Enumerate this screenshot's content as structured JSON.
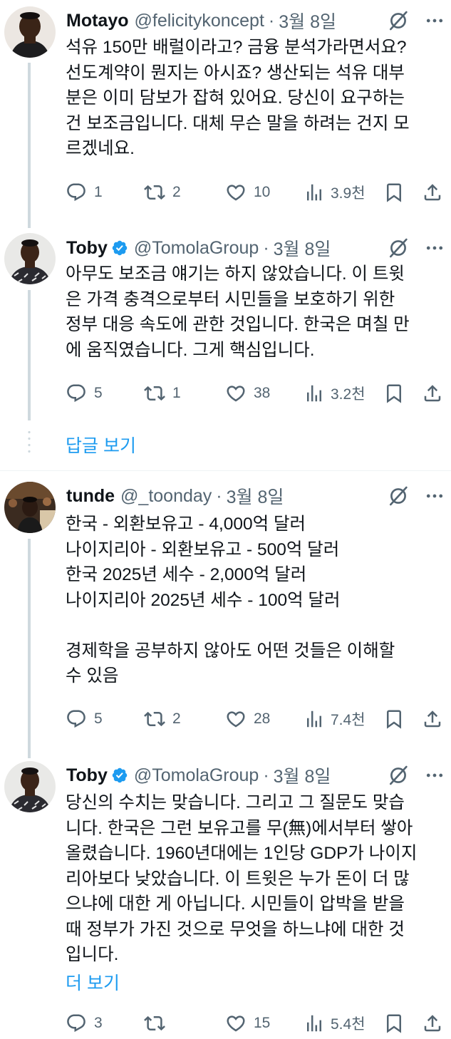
{
  "tweets": [
    {
      "name": "Motayo",
      "handle": "@felicitykoncept",
      "dot": "·",
      "date": "3월 8일",
      "verified": false,
      "lines": [
        "석유 150만 배럴이라고? 금융 분석가라면서요?",
        "선도계약이 뭔지는 아시죠? 생산되는 석유 대부",
        "분은 이미 담보가 잡혀 있어요. 당신이 요구하는",
        "건 보조금입니다. 대체 무슨 말을 하려는 건지 모",
        "르겠네요."
      ],
      "replies": "1",
      "reposts": "2",
      "likes": "10",
      "views": "3.9천"
    },
    {
      "name": "Toby",
      "handle": "@TomolaGroup",
      "dot": "·",
      "date": "3월 8일",
      "verified": true,
      "lines": [
        "아무도 보조금 얘기는 하지 않았습니다. 이 트윗",
        "은 가격 충격으로부터 시민들을 보호하기 위한",
        "정부 대응 속도에 관한 것입니다. 한국은 며칠 만",
        "에 움직였습니다. 그게 핵심입니다."
      ],
      "replies": "5",
      "reposts": "1",
      "likes": "38",
      "views": "3.2천"
    },
    {
      "name": "tunde",
      "handle": "@_toonday",
      "dot": "·",
      "date": "3월 8일",
      "verified": false,
      "lines": [
        "한국 - 외환보유고 - 4,000억 달러",
        "나이지리아 - 외환보유고 - 500억 달러",
        "한국 2025년 세수 - 2,000억 달러",
        "나이지리아 2025년 세수 - 100억 달러",
        "",
        "경제학을 공부하지 않아도 어떤 것들은 이해할",
        "수 있음"
      ],
      "replies": "5",
      "reposts": "2",
      "likes": "28",
      "views": "7.4천"
    },
    {
      "name": "Toby",
      "handle": "@TomolaGroup",
      "dot": "·",
      "date": "3월 8일",
      "verified": true,
      "lines": [
        "당신의 수치는 맞습니다. 그리고 그 질문도 맞습",
        "니다. 한국은 그런 보유고를 무(無)에서부터 쌓아",
        "올렸습니다. 1960년대에는 1인당 GDP가 나이지",
        "리아보다 낮았습니다. 이 트윗은 누가 돈이 더 많",
        "으냐에 대한 게 아닙니다. 시민들이 압박을 받을",
        "때 정부가 가진 것으로 무엇을 하느냐에 대한 것",
        "입니다."
      ],
      "show_more": "더 보기",
      "replies": "3",
      "reposts": "",
      "likes": "15",
      "views": "5.4천"
    }
  ],
  "show_replies": "답글 보기",
  "icons": {
    "reply": "speech-bubble-icon",
    "repost": "repost-arrows-icon",
    "like": "heart-icon",
    "views": "bar-chart-icon",
    "bookmark": "bookmark-icon",
    "share": "share-upload-icon",
    "grok": "slashed-circle-icon",
    "more": "ellipsis-icon",
    "verified": "verified-badge-icon"
  },
  "colors": {
    "text": "#0f1419",
    "secondary": "#536471",
    "link": "#1d9bf0",
    "verified": "#1d9bf0",
    "thread_line": "#cfd9de"
  }
}
